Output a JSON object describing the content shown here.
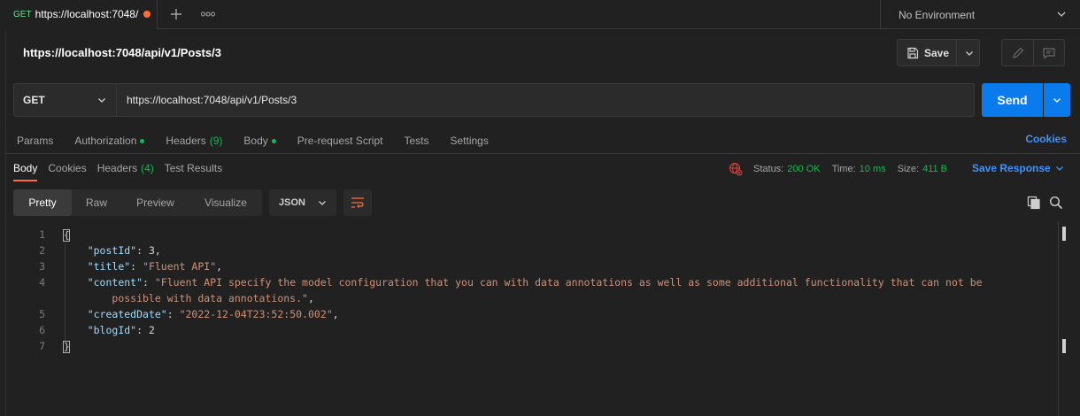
{
  "tab": {
    "method": "GET",
    "url": "https://localhost:7048/",
    "modified": true
  },
  "environment": {
    "label": "No Environment"
  },
  "request": {
    "title": "https://localhost:7048/api/v1/Posts/3",
    "method": "GET",
    "url": "https://localhost:7048/api/v1/Posts/3",
    "save_label": "Save",
    "send_label": "Send"
  },
  "request_tabs": [
    {
      "label": "Params"
    },
    {
      "label": "Authorization",
      "dot": true
    },
    {
      "label": "Headers",
      "count": "(9)"
    },
    {
      "label": "Body",
      "dot": true
    },
    {
      "label": "Pre-request Script"
    },
    {
      "label": "Tests"
    },
    {
      "label": "Settings"
    }
  ],
  "cookies_link": "Cookies",
  "response_tabs": [
    {
      "label": "Body",
      "active": true
    },
    {
      "label": "Cookies"
    },
    {
      "label": "Headers",
      "count": "(4)"
    },
    {
      "label": "Test Results"
    }
  ],
  "status": {
    "status_label": "Status:",
    "status_value": "200 OK",
    "time_label": "Time:",
    "time_value": "10 ms",
    "size_label": "Size:",
    "size_value": "411 B"
  },
  "save_response_label": "Save Response",
  "view_modes": [
    "Pretty",
    "Raw",
    "Preview",
    "Visualize"
  ],
  "active_view": "Pretty",
  "format": "JSON",
  "code_lines": [
    {
      "n": "1"
    },
    {
      "n": "2"
    },
    {
      "n": "3"
    },
    {
      "n": "4"
    },
    {
      "n": "5"
    },
    {
      "n": "6"
    },
    {
      "n": "7"
    }
  ],
  "response_json": {
    "postId_key": "\"postId\"",
    "postId_val": "3",
    "title_key": "\"title\"",
    "title_val": "\"Fluent API\"",
    "content_key": "\"content\"",
    "content_val_1": "\"Fluent API specify the model configuration that you can with data annotations as well as some additional functionality that can not be",
    "content_val_2": "possible with data annotations.\"",
    "createdDate_key": "\"createdDate\"",
    "createdDate_val": "\"2022-12-04T23:52:50.002\"",
    "blogId_key": "\"blogId\"",
    "blogId_val": "2"
  },
  "colors": {
    "accent_orange": "#ff6c37",
    "send_blue": "#097bed",
    "link_blue": "#3f93ff",
    "status_green": "#0cbb52",
    "json_key": "#9cdcfe",
    "json_string": "#ce9178"
  }
}
